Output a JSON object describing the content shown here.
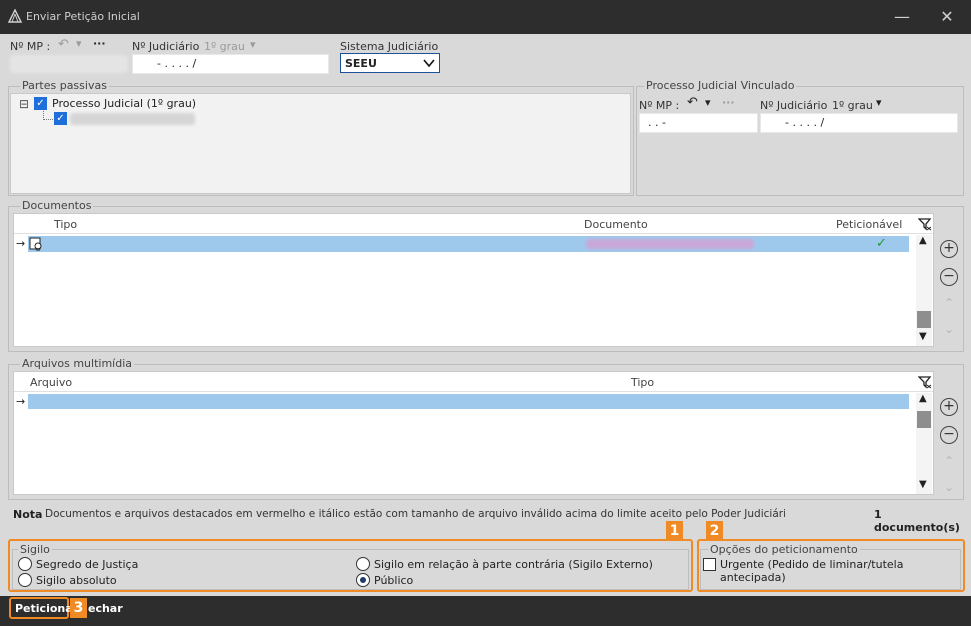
{
  "window": {
    "title": "Enviar Petição Inicial",
    "minimize": "—",
    "close": "✕"
  },
  "top": {
    "nmp_label": "Nº MP :",
    "undo_icon": "↶",
    "chevron": "▾",
    "ellipsis": "···",
    "nj_label": "Nº Judiciário",
    "nj_grade": "1º grau",
    "nj_value": "-  .    .  .  .        /",
    "sistema_label": "Sistema Judiciário",
    "sistema_value": "SEEU"
  },
  "partes": {
    "title": "Partes passivas",
    "tree_root_toggle": "⊟",
    "tree_root_label": "Processo Judicial (1º grau)"
  },
  "vinculado": {
    "title": "Processo Judicial Vinculado",
    "nmp_label": "Nº MP :",
    "nmp_value": ".      .        -",
    "nj_label": "Nº Judiciário",
    "nj_grade": "1º grau",
    "nj_value": "-  .    .  .  .        /"
  },
  "documentos": {
    "title": "Documentos",
    "columns": [
      "Tipo",
      "Documento",
      "Peticionável"
    ],
    "row_arrow": "→",
    "row_check": "✓"
  },
  "multimidia": {
    "title": "Arquivos multimídia",
    "columns": [
      "Arquivo",
      "Tipo"
    ],
    "row_arrow": "→"
  },
  "side_buttons": {
    "add": "+",
    "remove": "−",
    "up": "⌃",
    "down": "⌄"
  },
  "nota": {
    "label": "Nota",
    "text": "Documentos e arquivos destacados em vermelho e itálico estão com tamanho de arquivo inválido acima do limite aceito pelo Poder Judiciário.",
    "count": "1 documento(s)"
  },
  "sigilo": {
    "title": "Sigilo",
    "options": [
      "Segredo de Justiça",
      "Sigilo absoluto",
      "Sigilo em relação à parte contrária (Sigilo Externo)",
      "Público"
    ],
    "selected": "Público"
  },
  "opcoes": {
    "title": "Opções do peticionamento",
    "urgente_label": "Urgente (Pedido de liminar/tutela antecipada)"
  },
  "badges": [
    "1",
    "2",
    "3"
  ],
  "footer": {
    "peticionar": "Peticionar",
    "fechar": "echar"
  },
  "colors": {
    "accent_orange": "#f08a24",
    "selection_blue": "#9fc9ec",
    "titlebar": "#2d2d2d"
  }
}
